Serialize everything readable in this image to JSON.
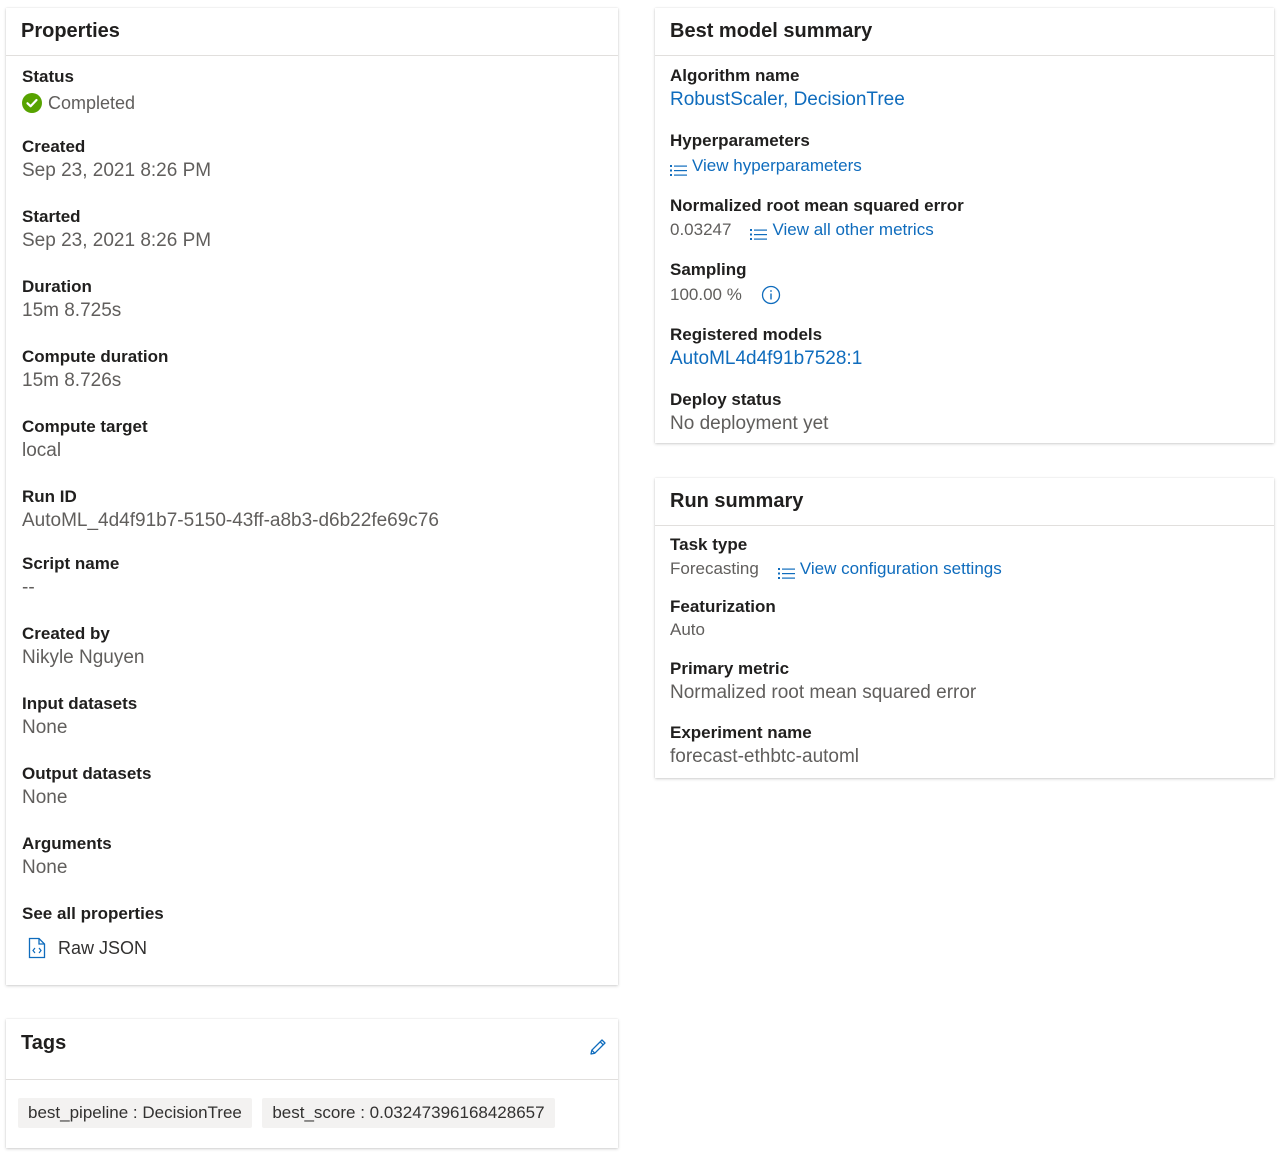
{
  "properties": {
    "title": "Properties",
    "status_label": "Status",
    "status_value": "Completed",
    "created_label": "Created",
    "created_value": "Sep 23, 2021 8:26 PM",
    "started_label": "Started",
    "started_value": "Sep 23, 2021 8:26 PM",
    "duration_label": "Duration",
    "duration_value": "15m 8.725s",
    "compute_duration_label": "Compute duration",
    "compute_duration_value": "15m 8.726s",
    "compute_target_label": "Compute target",
    "compute_target_value": "local",
    "run_id_label": "Run ID",
    "run_id_value": "AutoML_4d4f91b7-5150-43ff-a8b3-d6b22fe69c76",
    "script_name_label": "Script name",
    "script_name_value": "--",
    "created_by_label": "Created by",
    "created_by_value": "Nikyle Nguyen",
    "input_datasets_label": "Input datasets",
    "input_datasets_value": "None",
    "output_datasets_label": "Output datasets",
    "output_datasets_value": "None",
    "arguments_label": "Arguments",
    "arguments_value": "None",
    "see_all_label": "See all properties",
    "raw_json_label": "Raw JSON"
  },
  "tags": {
    "title": "Tags",
    "items": [
      "best_pipeline : DecisionTree",
      "best_score : 0.03247396168428657"
    ]
  },
  "best_model": {
    "title": "Best model summary",
    "algorithm_label": "Algorithm name",
    "algorithm_value": "RobustScaler, DecisionTree",
    "hyperparameters_label": "Hyperparameters",
    "hyperparameters_link": "View hyperparameters",
    "nrmse_label": "Normalized root mean squared error",
    "nrmse_value": "0.03247",
    "metrics_link": "View all other metrics",
    "sampling_label": "Sampling",
    "sampling_value": "100.00 %",
    "registered_label": "Registered models",
    "registered_value": "AutoML4d4f91b7528:1",
    "deploy_label": "Deploy status",
    "deploy_value": "No deployment yet"
  },
  "run_summary": {
    "title": "Run summary",
    "task_type_label": "Task type",
    "task_type_value": "Forecasting",
    "config_link": "View configuration settings",
    "featurization_label": "Featurization",
    "featurization_value": "Auto",
    "primary_metric_label": "Primary metric",
    "primary_metric_value": "Normalized root mean squared error",
    "experiment_label": "Experiment name",
    "experiment_value": "forecast-ethbtc-automl"
  },
  "colors": {
    "link": "#0f6cbd",
    "success": "#57a300",
    "label": "#201f1e",
    "value": "#605e5c"
  }
}
